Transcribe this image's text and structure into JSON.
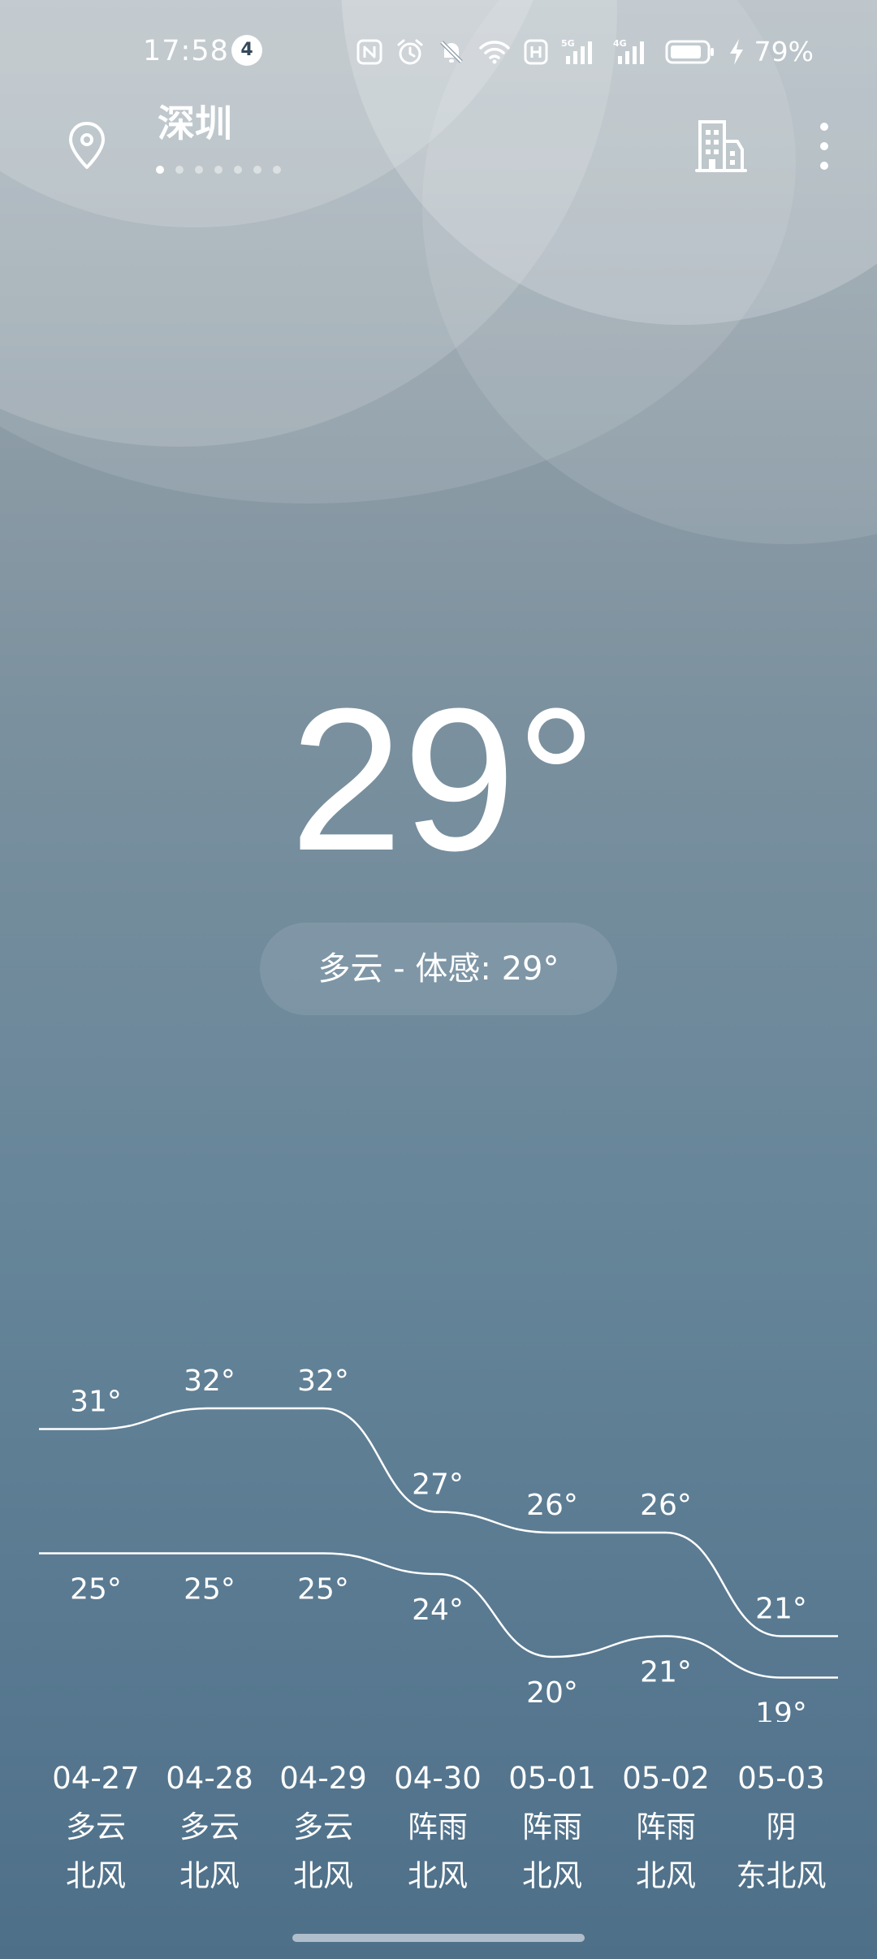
{
  "status_bar": {
    "time": "17:58",
    "notification_count": "4",
    "battery_percent": "79%",
    "icons": [
      "nfc-icon",
      "alarm-icon",
      "mute-icon",
      "wifi-icon",
      "hd-icon",
      "signal-5g-icon",
      "signal-4g-icon",
      "battery-icon",
      "charging-icon"
    ]
  },
  "header": {
    "city": "深圳",
    "page_count": 7,
    "active_page": 0,
    "icons": [
      "location-pin-icon",
      "city-buildings-icon",
      "more-vertical-icon"
    ]
  },
  "current": {
    "temperature": "29°",
    "condition_text": "多云 - 体感: 29°"
  },
  "forecast": {
    "days": [
      {
        "date": "04-27",
        "weather": "多云",
        "wind": "北风"
      },
      {
        "date": "04-28",
        "weather": "多云",
        "wind": "北风"
      },
      {
        "date": "04-29",
        "weather": "多云",
        "wind": "北风"
      },
      {
        "date": "04-30",
        "weather": "阵雨",
        "wind": "北风"
      },
      {
        "date": "05-01",
        "weather": "阵雨",
        "wind": "北风"
      },
      {
        "date": "05-02",
        "weather": "阵雨",
        "wind": "北风"
      },
      {
        "date": "05-03",
        "weather": "阴",
        "wind": "东北风"
      }
    ]
  },
  "chart_data": {
    "type": "line",
    "categories": [
      "04-27",
      "04-28",
      "04-29",
      "04-30",
      "05-01",
      "05-02",
      "05-03"
    ],
    "series": [
      {
        "values": [
          31,
          32,
          32,
          27,
          26,
          26,
          21
        ]
      },
      {
        "values": [
          25,
          25,
          25,
          24,
          20,
          21,
          19
        ]
      }
    ],
    "labels_high": [
      "31°",
      "32°",
      "32°",
      "27°",
      "26°",
      "26°",
      "21°"
    ],
    "labels_low": [
      "25°",
      "25°",
      "25°",
      "24°",
      "20°",
      "21°",
      "19°"
    ],
    "grid": false,
    "line_color": "#ffffff"
  }
}
